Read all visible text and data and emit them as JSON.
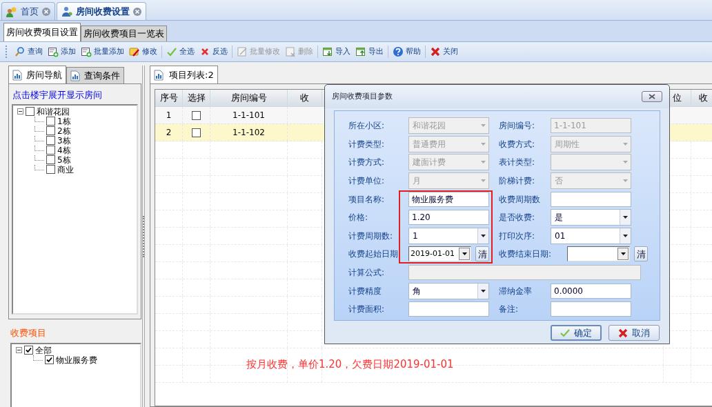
{
  "top_tabs": [
    {
      "label": "首页",
      "selected": false
    },
    {
      "label": "房间收费设置",
      "selected": true
    }
  ],
  "sub_tabs": [
    {
      "label": "房间收费项目设置",
      "selected": true
    },
    {
      "label": "房间收费项目一览表",
      "selected": false
    }
  ],
  "toolbar": [
    {
      "label": "查询",
      "disabled": false
    },
    {
      "label": "添加",
      "disabled": false
    },
    {
      "label": "批量添加",
      "disabled": false
    },
    {
      "label": "修改",
      "disabled": false
    },
    {
      "label": "全选",
      "disabled": false
    },
    {
      "label": "反选",
      "disabled": false
    },
    {
      "label": "批量修改",
      "disabled": true
    },
    {
      "label": "删除",
      "disabled": true
    },
    {
      "label": "导入",
      "disabled": false
    },
    {
      "label": "导出",
      "disabled": false
    },
    {
      "label": "帮助",
      "disabled": false
    },
    {
      "label": "关闭",
      "disabled": false
    }
  ],
  "left_panel": {
    "tabs": [
      {
        "label": "房间导航",
        "selected": true
      },
      {
        "label": "查询条件",
        "selected": false
      }
    ],
    "hint_link": "点击楼宇展开显示房间",
    "room_tree": [
      {
        "label": "和谐花园",
        "checked": false,
        "expanded": true,
        "children": [
          {
            "label": "1栋",
            "checked": false
          },
          {
            "label": "2栋",
            "checked": false
          },
          {
            "label": "3栋",
            "checked": false
          },
          {
            "label": "4栋",
            "checked": false
          },
          {
            "label": "5栋",
            "checked": false
          },
          {
            "label": "商业",
            "checked": false
          }
        ]
      }
    ],
    "fee_title": "收费项目",
    "fee_tree": [
      {
        "label": "全部",
        "checked": true,
        "expanded": true,
        "children": [
          {
            "label": "物业服务费",
            "checked": true
          }
        ]
      }
    ]
  },
  "list_panel": {
    "tab": "项目列表:2",
    "columns": [
      "序号",
      "选择",
      "房间编号",
      "收",
      "位",
      "收"
    ],
    "rows": [
      {
        "index": "1",
        "checked": false,
        "room": "1-1-101",
        "selected": false
      },
      {
        "index": "2",
        "checked": false,
        "room": "1-1-102",
        "selected": true
      }
    ]
  },
  "dialog": {
    "title": "房间收费项目参数",
    "rows": [
      {
        "left": {
          "label": "所在小区:",
          "kind": "select",
          "value": "和谐花园",
          "disabled": true
        },
        "right": {
          "label": "房间编号:",
          "kind": "text",
          "value": "1-1-101",
          "disabled": true
        }
      },
      {
        "left": {
          "label": "计费类型:",
          "kind": "select",
          "value": "普通费用",
          "disabled": true
        },
        "right": {
          "label": "收费方式:",
          "kind": "select",
          "value": "周期性",
          "disabled": true
        }
      },
      {
        "left": {
          "label": "计费方式:",
          "kind": "select",
          "value": "建面计费",
          "disabled": true
        },
        "right": {
          "label": "表计类型:",
          "kind": "select",
          "disabled": true
        }
      },
      {
        "left": {
          "label": "计费单位:",
          "kind": "select",
          "value": "月",
          "disabled": true
        },
        "right": {
          "label": "阶梯计费:",
          "kind": "select",
          "value": "否",
          "disabled": true
        }
      },
      {
        "left": {
          "label": "项目名称:",
          "kind": "text",
          "value": "物业服务费",
          "disabled": false
        },
        "right": {
          "label": "收费周期数",
          "kind": "text",
          "disabled": false
        }
      },
      {
        "left": {
          "label": "价格:",
          "kind": "text",
          "value": "1.20",
          "disabled": false
        },
        "right": {
          "label": "是否收费:",
          "kind": "select",
          "value": "是",
          "disabled": false
        }
      },
      {
        "left": {
          "label": "计费周期数:",
          "kind": "select",
          "value": "1",
          "disabled": false
        },
        "right": {
          "label": "打印次序:",
          "kind": "select",
          "value": "01",
          "disabled": false
        }
      },
      {
        "left": {
          "label": "收费起始日期",
          "kind": "date",
          "value": "2019-01-01",
          "clear": "清"
        },
        "right": {
          "label": "收费结束日期:",
          "kind": "date",
          "clear": "清"
        }
      },
      {
        "left": {
          "label": "计算公式:",
          "kind": "wide",
          "disabled": true
        }
      },
      {
        "left": {
          "label": "计费精度",
          "kind": "select",
          "value": "角",
          "disabled": false
        },
        "right": {
          "label": "滞纳金率",
          "kind": "text",
          "value": "0.0000",
          "disabled": false
        }
      },
      {
        "left": {
          "label": "计费面积:",
          "kind": "text",
          "disabled": false
        },
        "right": {
          "label": "备注:",
          "kind": "text",
          "disabled": false
        }
      }
    ],
    "buttons": [
      {
        "label": "确定",
        "kind": "ok"
      },
      {
        "label": "取消",
        "kind": "cancel"
      }
    ]
  },
  "annotation": "按月收费，单价1.20，欠费日期2019-01-01"
}
